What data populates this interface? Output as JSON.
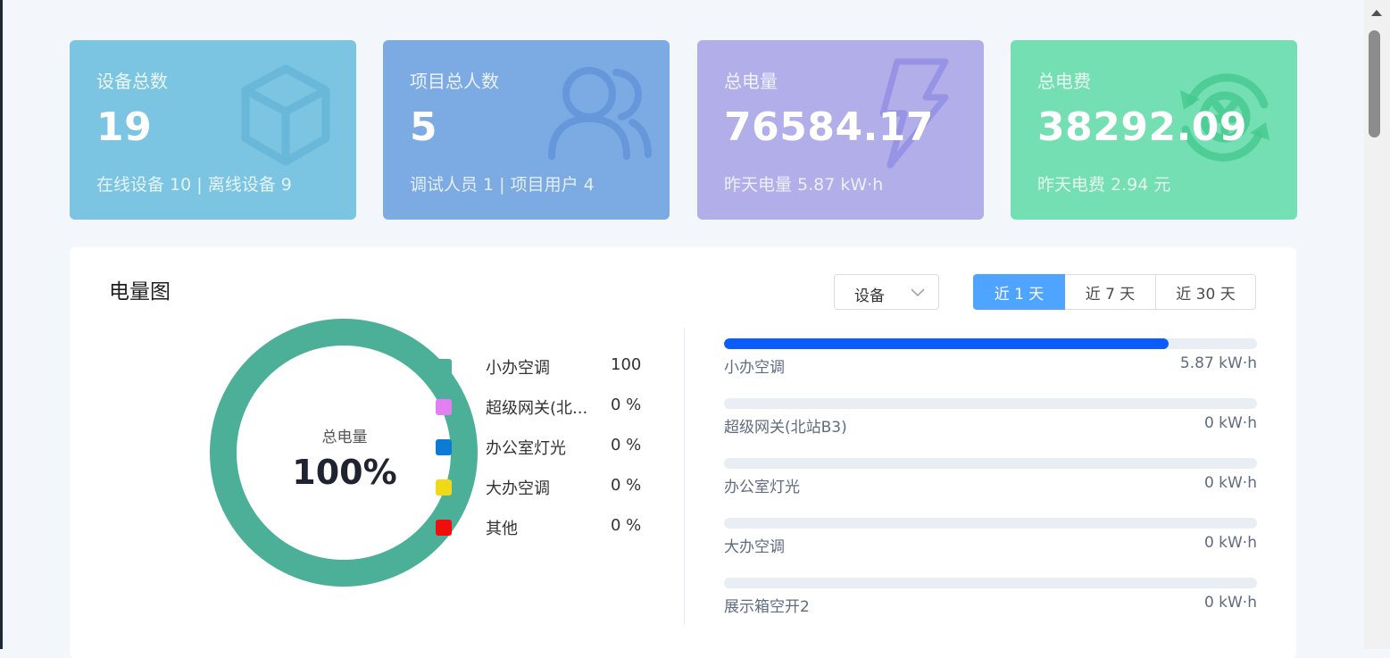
{
  "cards": [
    {
      "title": "设备总数",
      "value": "19",
      "sub": "在线设备 10 | 离线设备 9",
      "icon": "cube-icon",
      "color": "#7cc5e2"
    },
    {
      "title": "项目总人数",
      "value": "5",
      "sub": "调试人员 1 | 项目用户 4",
      "icon": "users-icon",
      "color": "#7caae3"
    },
    {
      "title": "总电量",
      "value": "76584.17",
      "sub": "昨天电量 5.87 kW·h",
      "icon": "lightning-icon",
      "color": "#b1aee9"
    },
    {
      "title": "总电费",
      "value": "38292.09",
      "sub": "昨天电费 2.94 元",
      "icon": "yen-cycle-icon",
      "color": "#73dfb3"
    }
  ],
  "panel": {
    "title": "电量图",
    "select": {
      "value": "设备"
    },
    "ranges": [
      {
        "label": "近 1 天",
        "active": true
      },
      {
        "label": "近 7 天",
        "active": false
      },
      {
        "label": "近 30 天",
        "active": false
      }
    ],
    "donut": {
      "label": "总电量",
      "value": "100%",
      "color": "#4caf98"
    },
    "legend": [
      {
        "name": "小办空调",
        "pct": "100",
        "color": "#4caf98"
      },
      {
        "name": "超级网关(北...",
        "pct": "0 %",
        "color": "#e27ff1"
      },
      {
        "name": "办公室灯光",
        "pct": "0 %",
        "color": "#0b7bd4"
      },
      {
        "name": "大办空调",
        "pct": "0 %",
        "color": "#f0d916"
      },
      {
        "name": "其他",
        "pct": "0 %",
        "color": "#f20c0c"
      }
    ],
    "bars": [
      {
        "name": "小办空调",
        "value": "5.87 kW·h",
        "fraction": 0.834
      },
      {
        "name": "超级网关(北站B3)",
        "value": "0 kW·h",
        "fraction": 0
      },
      {
        "name": "办公室灯光",
        "value": "0 kW·h",
        "fraction": 0
      },
      {
        "name": "大办空调",
        "value": "0 kW·h",
        "fraction": 0
      },
      {
        "name": "展示箱空开2",
        "value": "0 kW·h",
        "fraction": 0
      }
    ]
  }
}
